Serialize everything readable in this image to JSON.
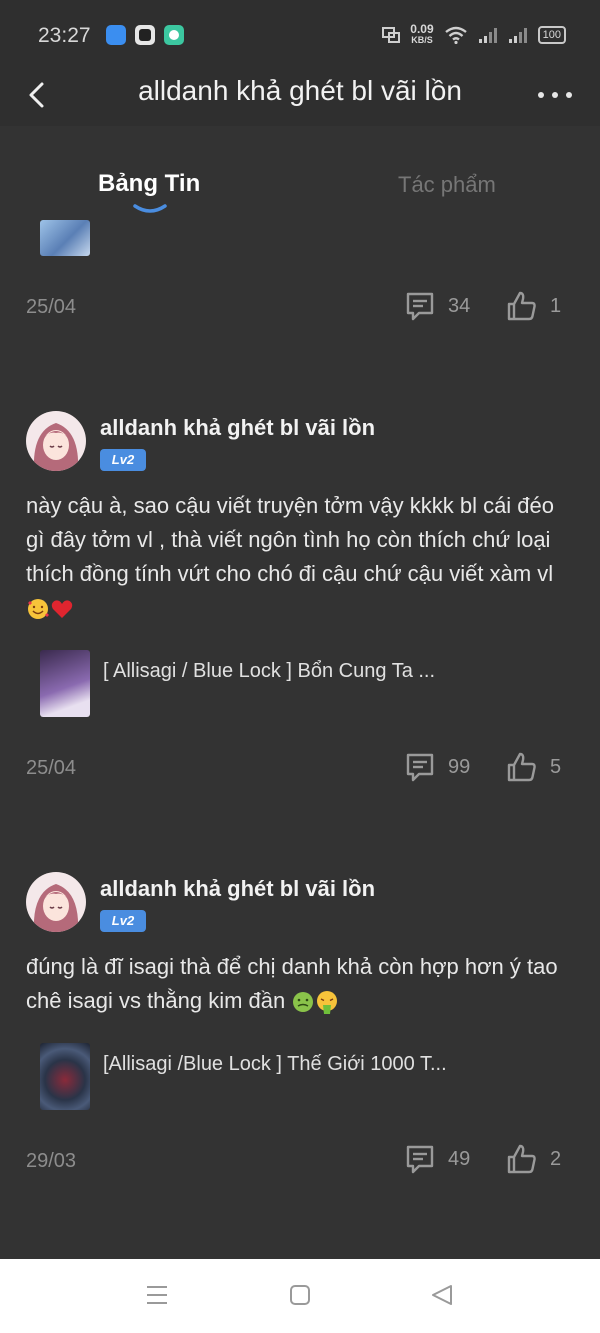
{
  "status_bar": {
    "time": "23:27",
    "net_speed_value": "0.09",
    "net_speed_unit": "KB/S",
    "battery": "100"
  },
  "header": {
    "title": "alldanh khả ghét bl vãi lồn"
  },
  "tabs": [
    {
      "label": "Bảng Tin",
      "active": true
    },
    {
      "label": "Tác phẩm",
      "active": false
    }
  ],
  "posts": [
    {
      "date": "25/04",
      "comments": "34",
      "likes": "1"
    },
    {
      "author": "alldanh khả ghét bl vãi lồn",
      "level": "Lv2",
      "text": "này cậu à, sao cậu viết truyện tởm vậy kkkk bl cái đéo gì đây tởm vl , thà viết ngôn tình họ còn thích chứ loại thích đồng tính vứt cho chó đi cậu chứ cậu viết xàm vl",
      "emojis": [
        "smiling-face-with-hearts",
        "red-heart"
      ],
      "work_title": "[ Allisagi / Blue Lock ] Bổn Cung Ta ...",
      "date": "25/04",
      "comments": "99",
      "likes": "5"
    },
    {
      "author": "alldanh khả ghét bl vãi lồn",
      "level": "Lv2",
      "text": "đúng là đĩ isagi thà để chị danh khả còn hợp hơn ý tao chê isagi vs thằng kim đần",
      "emojis": [
        "nauseated-face",
        "face-vomiting"
      ],
      "work_title": "[Allisagi /Blue Lock ] Thế Giới 1000 T...",
      "date": "29/03",
      "comments": "49",
      "likes": "2"
    }
  ],
  "colors": {
    "background": "#333333",
    "header": "#2f2f2f",
    "accent": "#4a8de0",
    "muted": "#8d8d8d"
  }
}
